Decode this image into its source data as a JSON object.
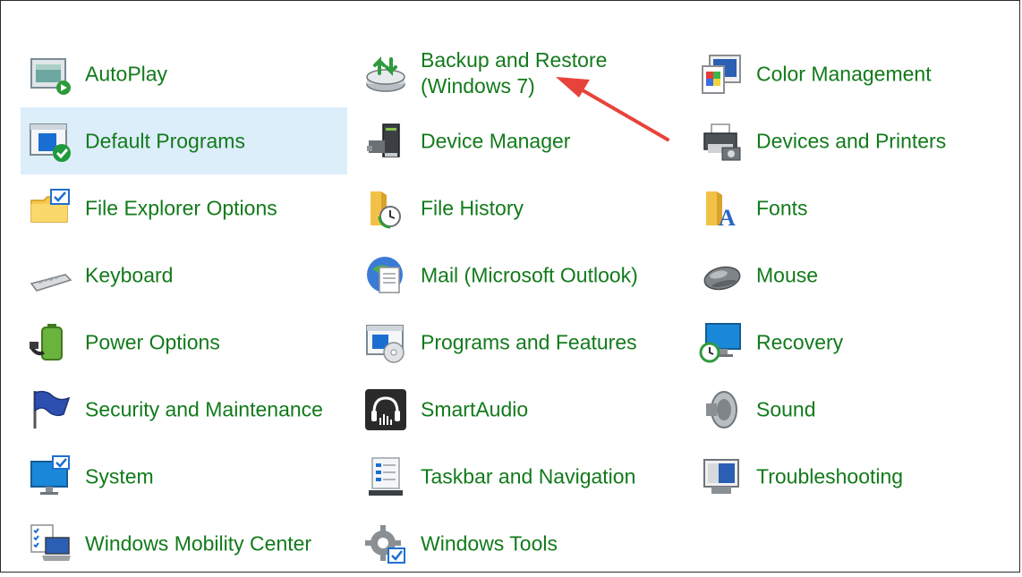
{
  "items": [
    {
      "label": "AutoPlay",
      "icon": "autoplay-icon"
    },
    {
      "label": "Backup and Restore",
      "label2": "(Windows 7)",
      "icon": "backup-restore-icon"
    },
    {
      "label": "Color Management",
      "icon": "color-management-icon"
    },
    {
      "label": "Default Programs",
      "icon": "default-programs-icon",
      "selected": true
    },
    {
      "label": "Device Manager",
      "icon": "device-manager-icon"
    },
    {
      "label": "Devices and Printers",
      "icon": "printer-icon"
    },
    {
      "label": "File Explorer Options",
      "icon": "folder-check-icon"
    },
    {
      "label": "File History",
      "icon": "file-history-icon"
    },
    {
      "label": "Fonts",
      "icon": "fonts-icon"
    },
    {
      "label": "Keyboard",
      "icon": "keyboard-icon"
    },
    {
      "label": "Mail (Microsoft Outlook)",
      "icon": "mail-icon"
    },
    {
      "label": "Mouse",
      "icon": "mouse-icon"
    },
    {
      "label": "Power Options",
      "icon": "battery-plug-icon"
    },
    {
      "label": "Programs and Features",
      "icon": "programs-features-icon"
    },
    {
      "label": "Recovery",
      "icon": "recovery-icon"
    },
    {
      "label": "Security and Maintenance",
      "icon": "flag-icon"
    },
    {
      "label": "SmartAudio",
      "icon": "headphones-icon"
    },
    {
      "label": "Sound",
      "icon": "speaker-icon"
    },
    {
      "label": "System",
      "icon": "monitor-check-icon"
    },
    {
      "label": "Taskbar and Navigation",
      "icon": "taskbar-icon"
    },
    {
      "label": "Troubleshooting",
      "icon": "troubleshooting-icon"
    },
    {
      "label": "Windows Mobility Center",
      "icon": "laptop-checklist-icon"
    },
    {
      "label": "Windows Tools",
      "icon": "gear-icon"
    }
  ],
  "colors": {
    "link": "#127a1b",
    "selected_bg": "#ddeefb",
    "annotation_arrow": "#e8433b"
  }
}
